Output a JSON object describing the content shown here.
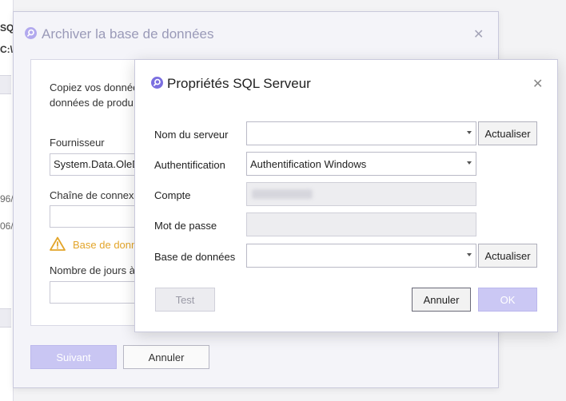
{
  "background": {
    "frag_sql": "SQL",
    "frag_path": "C:\\",
    "frag_date1": "96/",
    "frag_date2": "06/"
  },
  "archive_dialog": {
    "title": "Archiver la base de données",
    "description_line1": "Copiez vos donnée",
    "description_line2": "données de produ",
    "provider_label": "Fournisseur",
    "provider_value": "System.Data.OleD",
    "connection_label": "Chaîne de connexio",
    "connection_value": "",
    "warning_text": "Base de donn",
    "days_label": "Nombre de jours à",
    "days_value": "",
    "next_button": "Suivant",
    "cancel_button": "Annuler"
  },
  "sql_dialog": {
    "title": "Propriétés SQL Serveur",
    "server_label": "Nom du serveur",
    "server_value": "",
    "refresh_button_1": "Actualiser",
    "auth_label": "Authentification",
    "auth_value": "Authentification Windows",
    "account_label": "Compte",
    "password_label": "Mot de passe",
    "database_label": "Base de données",
    "database_value": "",
    "refresh_button_2": "Actualiser",
    "test_button": "Test",
    "cancel_button": "Annuler",
    "ok_button": "OK"
  },
  "colors": {
    "accent": "#7b6fe0",
    "accent_light": "#c9c6f3",
    "warning": "#e3a52a"
  },
  "icons": {
    "title_icon": "search-magnifier-icon",
    "close": "close-icon",
    "warning": "warning-triangle-icon",
    "dropdown": "chevron-down-icon"
  }
}
